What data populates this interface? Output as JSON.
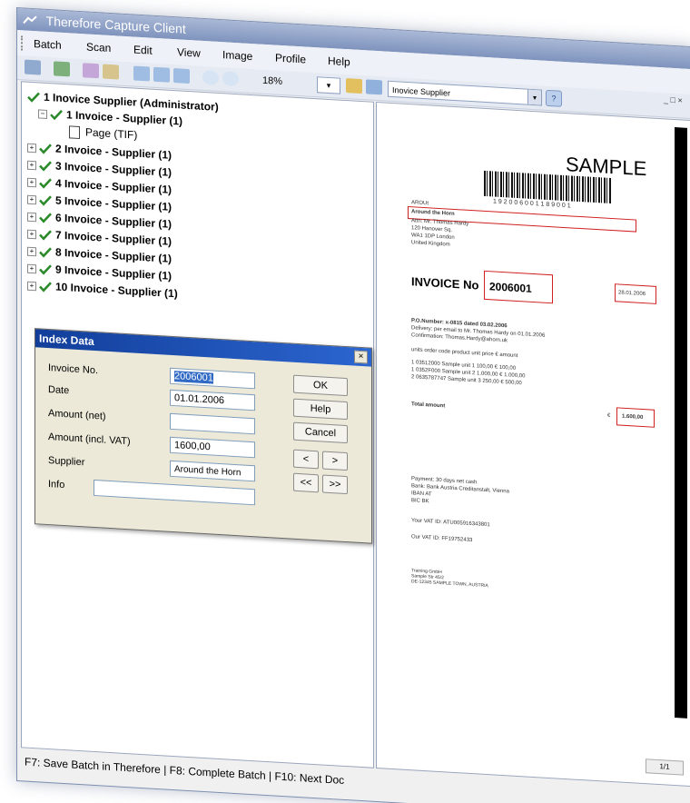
{
  "window": {
    "title": "Therefore Capture Client"
  },
  "menu": [
    "Batch",
    "Scan",
    "Edit",
    "View",
    "Image",
    "Profile",
    "Help"
  ],
  "toolbar": {
    "zoom": "18%",
    "combo_small": "▾",
    "profile": "Inovice Supplier",
    "help_icon": "?",
    "window_controls": "_ □ ×"
  },
  "tree": {
    "root": "1 Inovice Supplier (Administrator)",
    "first": "1 Invoice - Supplier (1)",
    "page": "Page (TIF)",
    "items": [
      "2 Invoice - Supplier (1)",
      "3 Invoice - Supplier (1)",
      "4 Invoice - Supplier (1)",
      "5 Invoice - Supplier (1)",
      "6 Invoice - Supplier (1)",
      "7 Invoice - Supplier (1)",
      "8 Invoice - Supplier (1)",
      "9 Invoice - Supplier (1)",
      "10 Invoice - Supplier (1)"
    ]
  },
  "index_dialog": {
    "title": "Index Data",
    "close": "×",
    "fields": [
      {
        "label": "Invoice No.",
        "value": "2006001"
      },
      {
        "label": "Date",
        "value": "01.01.2006"
      },
      {
        "label": "Amount (net)",
        "value": ""
      },
      {
        "label": "Amount (incl. VAT)",
        "value": "1600,00"
      },
      {
        "label": "Supplier",
        "value": "Around the Horn"
      },
      {
        "label": "Info",
        "value": ""
      }
    ],
    "buttons": {
      "ok": "OK",
      "help": "Help",
      "cancel": "Cancel"
    },
    "nav": {
      "prev": "<",
      "next": ">",
      "first": "<<",
      "last": ">>"
    }
  },
  "status": "F7: Save Batch in Therefore | F8: Complete Batch | F10: Next Doc",
  "document": {
    "sample": "SAMPLE",
    "barcode_digits": "1 9 2 0 0 6 0 0 1 1 8 9 0 0 1",
    "arou": "AROUt",
    "company": "Around the Horn",
    "address": [
      "Attn: Mr. Thomas Hardy",
      "120 Hanover Sq.",
      "WA1 1DP London",
      "United Kingdom"
    ],
    "invoice_label": "INVOICE  No",
    "invoice_no": "2006001",
    "date": "28.01.2006",
    "po_lines": [
      "P.O.Number:   x-0815 dated 03.02.2006",
      "Delivery:       per email to Mr. Thomas Hardy on 01.01.2006",
      "Confirmation:  Thomas.Hardy@ahorn.uk"
    ],
    "table_header": "units order code   product                                  unit price  €     amount",
    "rows": [
      "1    03512000    Sample unit 1                        100,00   €       100,00",
      "1    0352F000    Sample unit 2                     1.000,00   €    1.000,00",
      "2    0635787747  Sample unit 3                        250,00   €       500,00"
    ],
    "total_label": "Total amount",
    "total_currency": "€",
    "total_value": "1.600,00",
    "payment": [
      "Payment:     30 days net cash",
      "Bank:          Bank Austria Creditanstalt, Vienna",
      "                    IBAN AT",
      "                    BIC BK"
    ],
    "vat": [
      "Your VAT ID:   ATU005916343801",
      "Our VAT ID:     FF19752433"
    ],
    "footer": [
      "Training GmbH",
      "Sample Str 45/2",
      "DE-12345 SAMPLE TOWN, AUSTRIA"
    ],
    "page_indicator": "1/1"
  }
}
